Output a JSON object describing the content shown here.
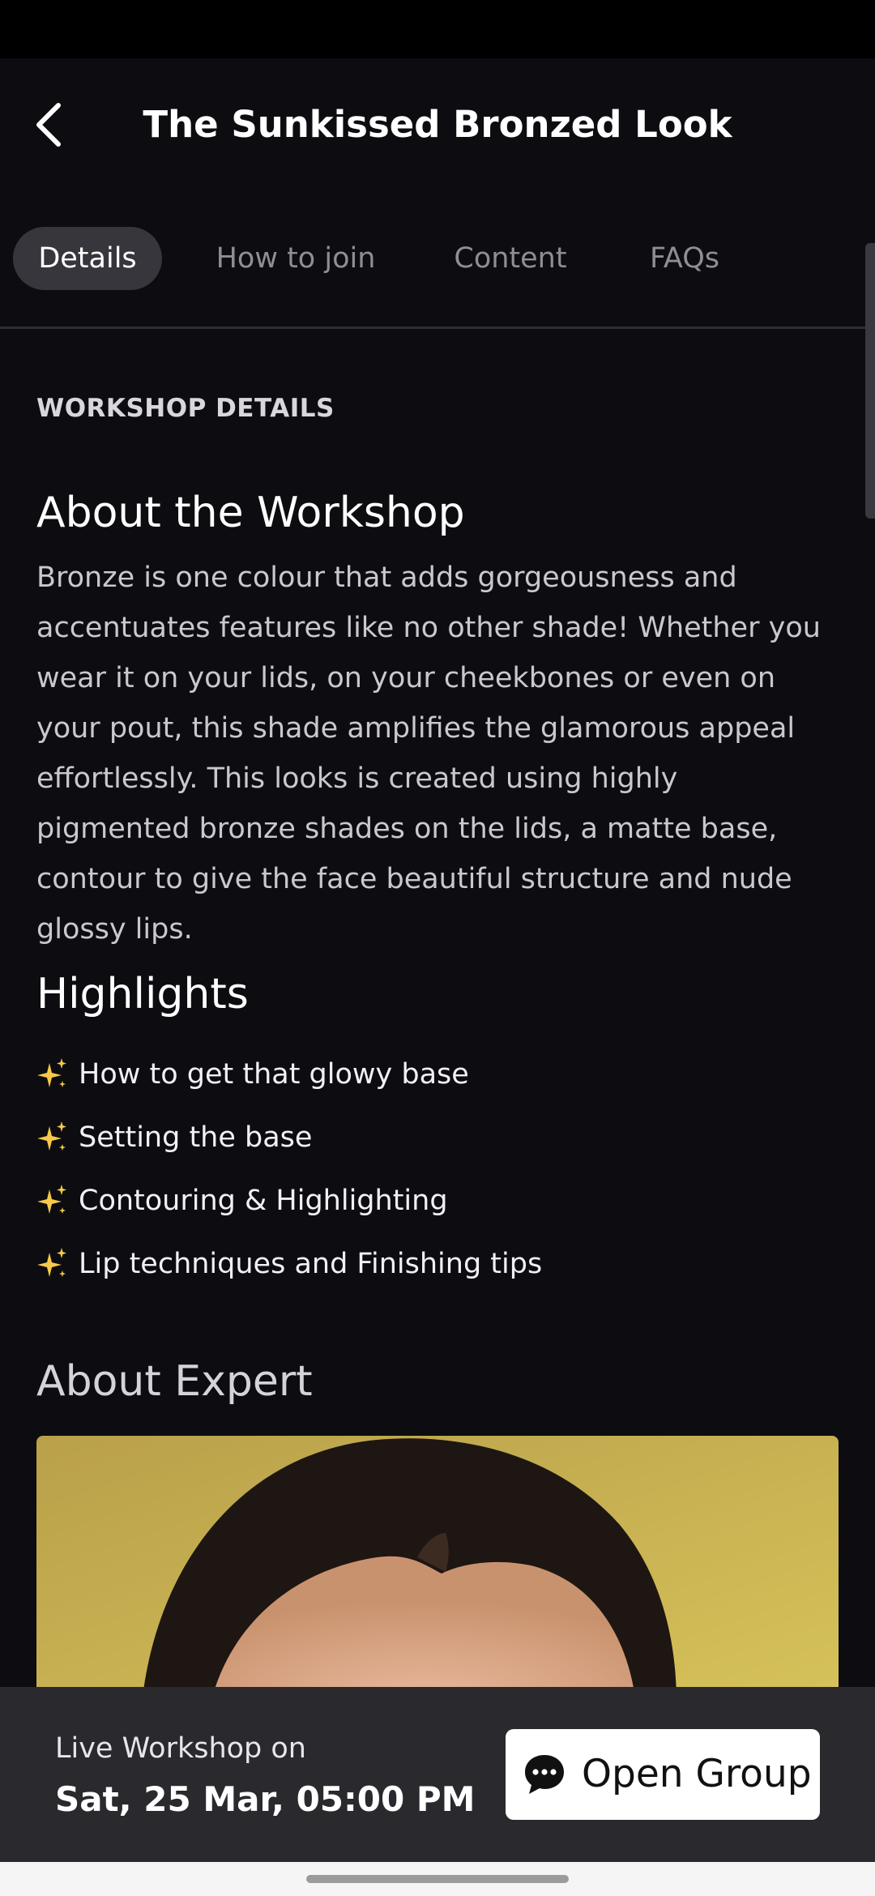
{
  "header": {
    "title": "The Sunkissed Bronzed Look",
    "back_icon": "chevron-left-icon"
  },
  "tabs": [
    {
      "label": "Details",
      "active": true
    },
    {
      "label": "How to join",
      "active": false
    },
    {
      "label": "Content",
      "active": false
    },
    {
      "label": "FAQs",
      "active": false
    }
  ],
  "details": {
    "section_label": "WORKSHOP DETAILS",
    "about_heading": "About the Workshop",
    "about_text": "Bronze is one colour that adds gorgeousness and accentuates features like no other shade! Whether you wear it on your lids, on your cheekbones or even on your pout, this shade amplifies the glamorous appeal effortlessly. This looks is created using highly pigmented bronze shades on the lids, a matte base, contour to give the face beautiful structure and nude glossy lips.",
    "highlights_heading": "Highlights",
    "highlights": [
      {
        "icon": "sparkles-icon",
        "text": "How to get that glowy base"
      },
      {
        "icon": "sparkles-icon",
        "text": "Setting the base"
      },
      {
        "icon": "sparkles-icon",
        "text": "Contouring & Highlighting"
      },
      {
        "icon": "sparkles-icon",
        "text": "Lip techniques and Finishing tips"
      }
    ],
    "expert_heading": "About Expert"
  },
  "bottom_bar": {
    "label": "Live Workshop on",
    "date": "Sat, 25 Mar, 05:00 PM",
    "button_label": "Open Group",
    "button_icon": "chat-bubble-icon"
  },
  "colors": {
    "background": "#0d0c11",
    "active_tab": "#37363c",
    "bottom_bar": "#2a292e",
    "sparkle": "#f7c948"
  }
}
